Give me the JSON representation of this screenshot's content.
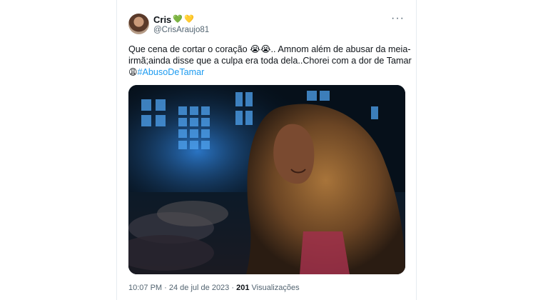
{
  "tweet": {
    "display_name": "Cris",
    "name_emojis": [
      "💚",
      "💛"
    ],
    "handle": "@CrisAraujo81",
    "more_label": "···",
    "text_lines": [
      "Que cena de cortar o coração 😭😭..  Amnom além de abusar da meia-",
      "irmã;ainda disse que a culpa era toda dela..Chorei com a dor de Tamar"
    ],
    "text_tail_emoji": "😩",
    "hashtag": "#AbusoDeTamar",
    "time": "10:07 PM",
    "separator": "·",
    "date": "24 de jul de 2023",
    "views_count": "201",
    "views_label": "Visualizações"
  }
}
